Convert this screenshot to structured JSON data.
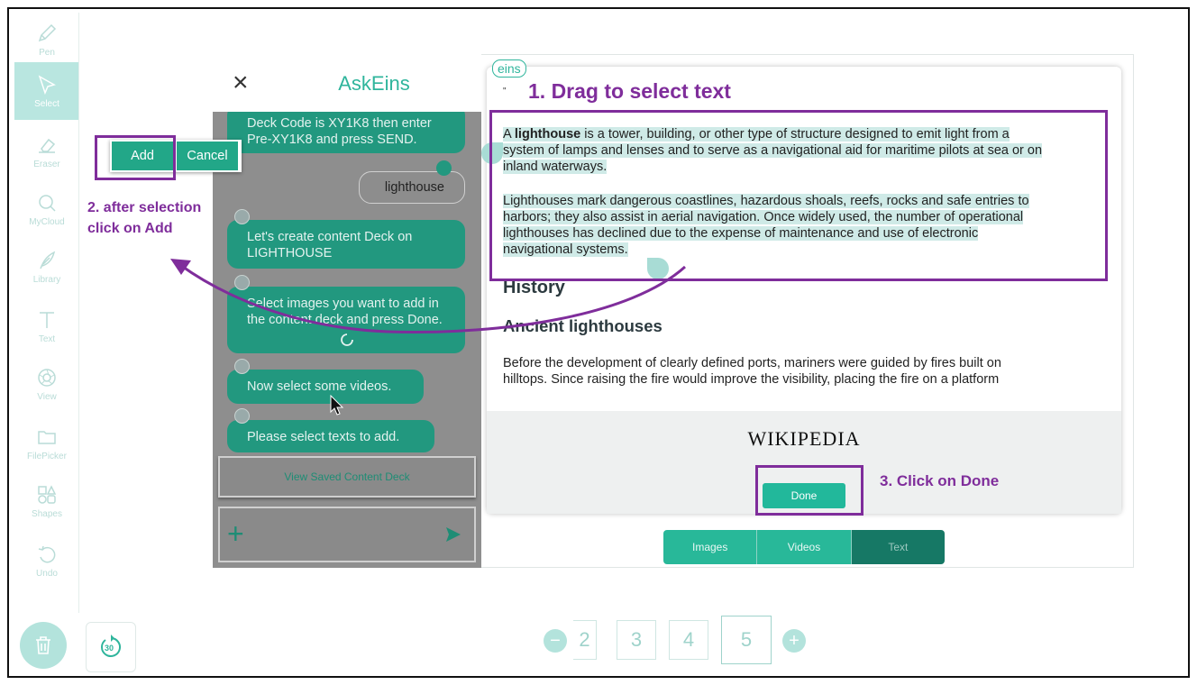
{
  "sidebar": {
    "tools": [
      {
        "label": "Pen",
        "icon": "pen-icon"
      },
      {
        "label": "Select",
        "icon": "select-cursor-icon"
      },
      {
        "label": "Eraser",
        "icon": "eraser-icon"
      },
      {
        "label": "MyCloud",
        "icon": "search-icon"
      },
      {
        "label": "Library",
        "icon": "feather-icon"
      },
      {
        "label": "Text",
        "icon": "text-icon"
      },
      {
        "label": "View",
        "icon": "aperture-icon"
      },
      {
        "label": "FilePicker",
        "icon": "folder-icon"
      },
      {
        "label": "Shapes",
        "icon": "shapes-icon"
      },
      {
        "label": "Undo",
        "icon": "undo-icon"
      }
    ],
    "active": "Select"
  },
  "bottom": {
    "timer_label": "30",
    "pages": [
      "2",
      "3",
      "4",
      "5"
    ],
    "current_page": "5",
    "minus": "−",
    "plus": "+"
  },
  "chat": {
    "title": "AskEins",
    "close": "×",
    "messages": [
      {
        "from": "bot",
        "text": "Deck Code is XY1K8 then enter Pre-XY1K8 and press SEND."
      },
      {
        "from": "user",
        "text": "lighthouse"
      },
      {
        "from": "bot",
        "text": "Let's create content Deck on LIGHTHOUSE"
      },
      {
        "from": "bot",
        "text": "Select images you want to add in the content deck and press Done."
      },
      {
        "from": "bot",
        "text": "Now select some videos."
      },
      {
        "from": "bot",
        "text": "Please select texts to add."
      }
    ],
    "view_saved_label": "View Saved Content Deck",
    "input_plus": "+"
  },
  "popup": {
    "add_label": "Add",
    "cancel_label": "Cancel"
  },
  "article": {
    "badge": "eins",
    "p1_bold": "lighthouse",
    "p1_line1_pre": "A ",
    "p1_line1_post": " is a tower, building, or other type of structure designed to emit light from a",
    "p1_line2": "system of lamps and lenses and to serve as a navigational aid for maritime pilots at sea or on",
    "p1_line3": "inland waterways.",
    "p2_line1": "Lighthouses mark dangerous coastlines, hazardous shoals, reefs, rocks and safe entries to",
    "p2_line2": "harbors; they also assist in aerial navigation. Once widely used, the number of operational",
    "p2_line3": "lighthouses has declined due to the expense of maintenance and use of electronic",
    "p2_line4": "navigational systems.",
    "h2": "History",
    "h3": "Ancient lighthouses",
    "p3_line1": "Before the development of clearly defined ports, mariners were guided by fires built on",
    "p3_line2": "hilltops. Since raising the fire would improve the visibility, placing the fire on a platform",
    "wiki_logo": "WIKIPEDIA",
    "done_label": "Done"
  },
  "tabs": {
    "items": [
      "Images",
      "Videos",
      "Text"
    ],
    "selected": "Text"
  },
  "annotations": {
    "step1": "1. Drag to select text",
    "step2_line1": "2. after selection",
    "step2_line2": "click on Add",
    "step3": "3. Click on Done",
    "color": "#7f2d9b"
  },
  "colors": {
    "accent": "#22a788",
    "accent_light": "#b3e3dc",
    "highlight": "#cfeae7",
    "annotation": "#7f2d9b"
  }
}
